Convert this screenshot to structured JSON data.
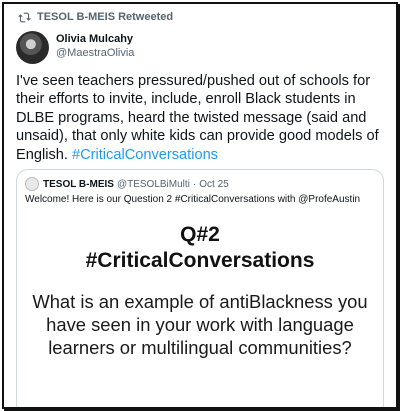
{
  "retweet": {
    "label": "TESOL B-MEIS Retweeted",
    "icon": "retweet-icon"
  },
  "tweet": {
    "author_name": "Olivia Mulcahy",
    "author_handle": "@MaestraOlivia",
    "text": "I've seen teachers pressured/pushed out of schools for their efforts to invite, include, enroll Black students in DLBE programs, heard the twisted message (said and unsaid), that only white kids can provide good models of English.",
    "hashtag": "#CriticalConversations",
    "hashtag_color": "#1d9bf0"
  },
  "quoted_tweet": {
    "author_name": "TESOL B-MEIS",
    "author_handle": "@TESOLBiMulti",
    "separator": "·",
    "date": "Oct 25",
    "text": "Welcome! Here is our Question 2 #CriticalConversations with @ProfeAustin",
    "image": {
      "question_number": "Q#2",
      "hashtag": "#CriticalConversations",
      "question": "What is an example of antiBlackness you have seen in your work with language learners or multilingual communities?"
    }
  }
}
